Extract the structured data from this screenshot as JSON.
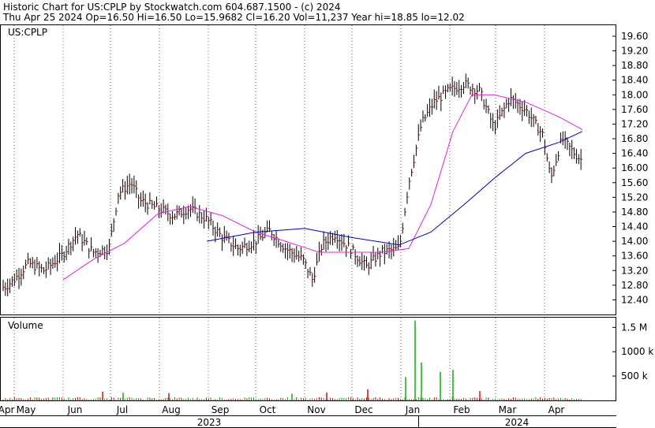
{
  "header": {
    "line1": "Historic Chart for US:CPLP by Stockwatch.com 604.687.1500 - (c) 2024",
    "line2": "Thu Apr 25 2024   Op=16.50   Hi=16.50   Lo=15.9682   Cl=16.20   Vol=11,237   Year hi=18.85   lo=12.02"
  },
  "chart_data": {
    "type": "ohlc",
    "symbol_label": "US:CPLP",
    "volume_label": "Volume",
    "colors": {
      "price_bar": "#000000",
      "price_tick": "#cc0000",
      "ma_short": "#e020e0",
      "ma_long": "#0000bb",
      "vol_up": "#00aa00",
      "vol_down": "#cc0000",
      "grid": "#000000"
    },
    "price_axis": {
      "ticks": [
        12.4,
        12.8,
        13.2,
        13.6,
        14.0,
        14.4,
        14.8,
        15.2,
        15.6,
        16.0,
        16.4,
        16.8,
        17.2,
        17.6,
        18.0,
        18.4,
        18.8,
        19.2,
        19.6
      ],
      "ylim": [
        12.0,
        19.9
      ]
    },
    "volume_axis": {
      "ticks": [
        {
          "value": 500000,
          "label": "500 k"
        },
        {
          "value": 1000000,
          "label": "1000 k"
        },
        {
          "value": 1500000,
          "label": "1.5 M"
        }
      ],
      "ylim": [
        0,
        1700000
      ]
    },
    "months": [
      "Apr",
      "May",
      "Jun",
      "Jul",
      "Aug",
      "Sep",
      "Oct",
      "Nov",
      "Dec",
      "Jan",
      "Feb",
      "Mar",
      "Apr"
    ],
    "years": [
      "2023",
      "2024"
    ],
    "closes": [
      {
        "date": "2023-04-25",
        "close": 12.75
      },
      {
        "date": "2023-05-01",
        "close": 12.95
      },
      {
        "date": "2023-05-10",
        "close": 13.4
      },
      {
        "date": "2023-05-20",
        "close": 13.2
      },
      {
        "date": "2023-05-31",
        "close": 13.6
      },
      {
        "date": "2023-06-10",
        "close": 14.2
      },
      {
        "date": "2023-06-20",
        "close": 13.7
      },
      {
        "date": "2023-06-30",
        "close": 13.8
      },
      {
        "date": "2023-07-06",
        "close": 15.3
      },
      {
        "date": "2023-07-14",
        "close": 15.6
      },
      {
        "date": "2023-07-20",
        "close": 15.1
      },
      {
        "date": "2023-07-31",
        "close": 14.9
      },
      {
        "date": "2023-08-10",
        "close": 14.7
      },
      {
        "date": "2023-08-20",
        "close": 14.9
      },
      {
        "date": "2023-08-31",
        "close": 14.6
      },
      {
        "date": "2023-09-10",
        "close": 14.1
      },
      {
        "date": "2023-09-20",
        "close": 13.8
      },
      {
        "date": "2023-10-01",
        "close": 14.0
      },
      {
        "date": "2023-10-10",
        "close": 14.3
      },
      {
        "date": "2023-10-20",
        "close": 13.8
      },
      {
        "date": "2023-10-31",
        "close": 13.5
      },
      {
        "date": "2023-11-06",
        "close": 12.95
      },
      {
        "date": "2023-11-12",
        "close": 13.9
      },
      {
        "date": "2023-11-20",
        "close": 14.2
      },
      {
        "date": "2023-11-30",
        "close": 13.8
      },
      {
        "date": "2023-12-10",
        "close": 13.3
      },
      {
        "date": "2023-12-20",
        "close": 13.7
      },
      {
        "date": "2023-12-31",
        "close": 13.8
      },
      {
        "date": "2024-01-06",
        "close": 15.6
      },
      {
        "date": "2024-01-14",
        "close": 17.2
      },
      {
        "date": "2024-01-22",
        "close": 17.8
      },
      {
        "date": "2024-01-31",
        "close": 18.1
      },
      {
        "date": "2024-02-10",
        "close": 18.3
      },
      {
        "date": "2024-02-20",
        "close": 18.1
      },
      {
        "date": "2024-02-29",
        "close": 17.1
      },
      {
        "date": "2024-03-10",
        "close": 17.9
      },
      {
        "date": "2024-03-20",
        "close": 17.6
      },
      {
        "date": "2024-03-31",
        "close": 16.9
      },
      {
        "date": "2024-04-05",
        "close": 15.7
      },
      {
        "date": "2024-04-12",
        "close": 16.8
      },
      {
        "date": "2024-04-20",
        "close": 16.4
      },
      {
        "date": "2024-04-25",
        "close": 16.2
      }
    ],
    "ma_short": [
      {
        "date": "2023-06-01",
        "value": 12.95
      },
      {
        "date": "2023-06-20",
        "value": 13.5
      },
      {
        "date": "2023-07-10",
        "value": 13.95
      },
      {
        "date": "2023-07-31",
        "value": 14.75
      },
      {
        "date": "2023-08-20",
        "value": 14.95
      },
      {
        "date": "2023-09-10",
        "value": 14.7
      },
      {
        "date": "2023-10-01",
        "value": 14.25
      },
      {
        "date": "2023-10-20",
        "value": 14.0
      },
      {
        "date": "2023-11-10",
        "value": 13.7
      },
      {
        "date": "2023-11-30",
        "value": 13.7
      },
      {
        "date": "2023-12-20",
        "value": 13.7
      },
      {
        "date": "2024-01-06",
        "value": 13.8
      },
      {
        "date": "2024-01-20",
        "value": 15.0
      },
      {
        "date": "2024-02-03",
        "value": 17.0
      },
      {
        "date": "2024-02-15",
        "value": 18.0
      },
      {
        "date": "2024-02-29",
        "value": 18.0
      },
      {
        "date": "2024-03-20",
        "value": 17.8
      },
      {
        "date": "2024-04-10",
        "value": 17.4
      },
      {
        "date": "2024-04-25",
        "value": 17.05
      }
    ],
    "ma_long": [
      {
        "date": "2023-08-31",
        "value": 14.0
      },
      {
        "date": "2023-10-01",
        "value": 14.25
      },
      {
        "date": "2023-11-01",
        "value": 14.35
      },
      {
        "date": "2023-12-01",
        "value": 14.1
      },
      {
        "date": "2023-12-31",
        "value": 13.9
      },
      {
        "date": "2024-01-20",
        "value": 14.25
      },
      {
        "date": "2024-02-10",
        "value": 15.0
      },
      {
        "date": "2024-03-01",
        "value": 15.75
      },
      {
        "date": "2024-03-20",
        "value": 16.4
      },
      {
        "date": "2024-04-10",
        "value": 16.7
      },
      {
        "date": "2024-04-25",
        "value": 17.0
      }
    ],
    "volume_spikes": [
      {
        "date": "2023-06-26",
        "volume": 180000,
        "dir": "down"
      },
      {
        "date": "2023-07-09",
        "volume": 160000,
        "dir": "up"
      },
      {
        "date": "2023-08-07",
        "volume": 150000,
        "dir": "down"
      },
      {
        "date": "2023-10-24",
        "volume": 140000,
        "dir": "up"
      },
      {
        "date": "2023-11-15",
        "volume": 160000,
        "dir": "down"
      },
      {
        "date": "2023-12-11",
        "volume": 230000,
        "dir": "down"
      },
      {
        "date": "2024-01-04",
        "volume": 480000,
        "dir": "up"
      },
      {
        "date": "2024-01-10",
        "volume": 1640000,
        "dir": "up"
      },
      {
        "date": "2024-01-14",
        "volume": 780000,
        "dir": "up"
      },
      {
        "date": "2024-01-26",
        "volume": 590000,
        "dir": "up"
      },
      {
        "date": "2024-02-03",
        "volume": 630000,
        "dir": "up"
      },
      {
        "date": "2024-02-20",
        "volume": 190000,
        "dir": "down"
      }
    ]
  }
}
